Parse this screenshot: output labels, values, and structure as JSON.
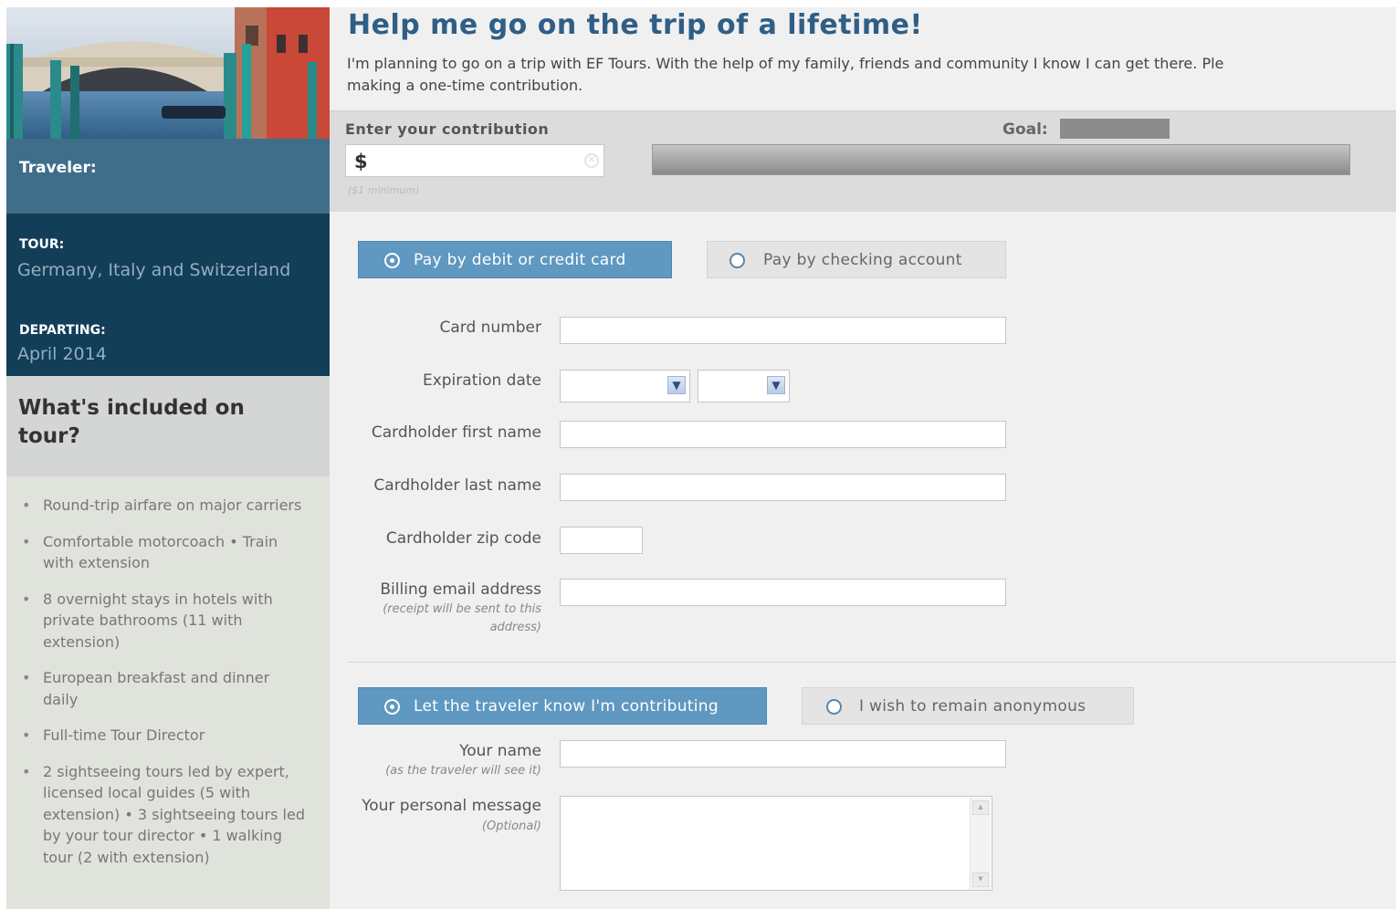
{
  "sidebar": {
    "traveler_label": "Traveler:",
    "tour_key": "TOUR:",
    "tour_value": "Germany, Italy and Switzerland",
    "departing_key": "DEPARTING:",
    "departing_value": "April 2014",
    "included_title": "What's included on tour?",
    "included_items": [
      "Round-trip airfare on major carriers",
      "Comfortable motorcoach • Train with extension",
      "8 overnight stays in hotels with private bathrooms (11 with extension)",
      "European breakfast and dinner daily",
      "Full-time Tour Director",
      "2 sightseeing tours led by expert, licensed local guides (5 with extension) • 3 sightseeing tours led by your tour director • 1 walking tour (2 with extension)"
    ]
  },
  "main": {
    "title": "Help me go on the trip of a lifetime!",
    "intro": "I'm planning to go on a trip with EF Tours. With the help of my family, friends and community I know I can get there. Ple",
    "intro_line2": "making a one-time contribution.",
    "contribution": {
      "label": "Enter your contribution",
      "currency": "$",
      "minimum_note": "($1 minimum)",
      "goal_label": "Goal:"
    },
    "payment_tabs": {
      "card_label": "Pay by debit or credit card",
      "checking_label": "Pay by checking account",
      "selected": "card"
    },
    "card_form": {
      "card_number_label": "Card number",
      "expiration_label": "Expiration date",
      "first_name_label": "Cardholder first name",
      "last_name_label": "Cardholder last name",
      "zip_label": "Cardholder zip code",
      "email_label": "Billing email address",
      "email_note": "(receipt will be sent to this address)"
    },
    "visibility_tabs": {
      "notify_label": "Let the traveler know I'm contributing",
      "anonymous_label": "I wish to remain anonymous",
      "selected": "notify"
    },
    "personal": {
      "name_label": "Your name",
      "name_note": "(as the traveler will see it)",
      "message_label": "Your personal message",
      "message_note": "(Optional)"
    }
  },
  "colors": {
    "title": "#2f5e86",
    "active_tab": "#5f98c0",
    "traveler_band": "#3f6e8a",
    "tour_band": "#123e58"
  }
}
